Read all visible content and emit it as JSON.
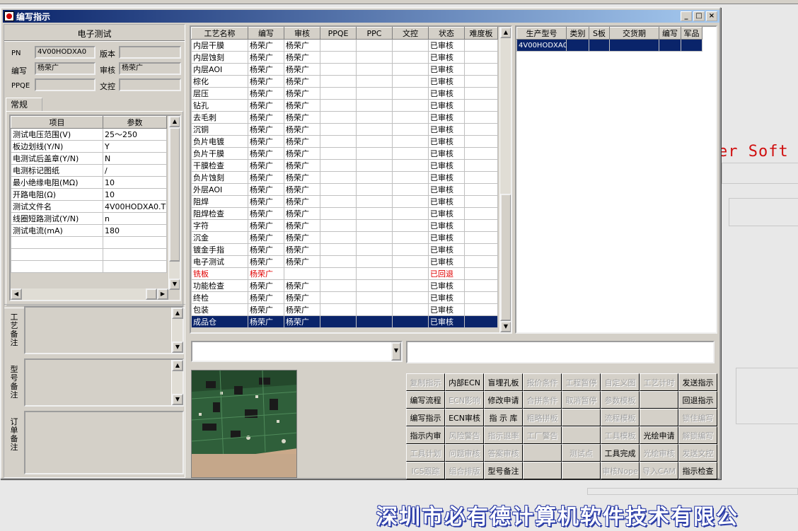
{
  "window": {
    "title": "编写指示",
    "min": "_",
    "max": "□",
    "close": "×"
  },
  "desktop": {
    "soft_text": "er Soft",
    "company_text": "深圳市必有德计算机软件技术有限公"
  },
  "left": {
    "section_title": "电子测试",
    "pn_label": "PN",
    "pn_value": "4V00HODXA0",
    "version_label": "版本",
    "version_value": "",
    "writer_label": "编写",
    "writer_value": "杨荣广",
    "reviewer_label": "审核",
    "reviewer_value": "杨荣广",
    "ppqe_label": "PPQE",
    "ppqe_value": "",
    "control_label": "文控",
    "control_value": "",
    "tab_label": "常规",
    "param_headers": [
      "项目",
      "参数"
    ],
    "params": [
      [
        "测试电压范围(V)",
        "25～250"
      ],
      [
        "板边划线(Y/N)",
        "Y"
      ],
      [
        "电测试后盖章(Y/N)",
        "N"
      ],
      [
        "电测标记图纸",
        "/"
      ],
      [
        "最小绝缘电阻(MΩ)",
        "10"
      ],
      [
        "开路电阻(Ω)",
        "10"
      ],
      [
        "测试文件名",
        "4V00HODXA0.TGZ"
      ],
      [
        "线圈短路测试(Y/N)",
        "n"
      ],
      [
        "测试电流(mA)",
        "180"
      ]
    ],
    "notes": [
      {
        "label": "工艺备注",
        "value": ""
      },
      {
        "label": "型号备注",
        "value": ""
      },
      {
        "label": "订单备注",
        "value": ""
      }
    ]
  },
  "process": {
    "headers": [
      "工艺名称",
      "编写",
      "审核",
      "PPQE",
      "PPC",
      "文控",
      "状态",
      "难度板"
    ],
    "rows": [
      [
        "内层干膜",
        "杨荣广",
        "杨荣广",
        "",
        "",
        "",
        "已审核",
        ""
      ],
      [
        "内层蚀刻",
        "杨荣广",
        "杨荣广",
        "",
        "",
        "",
        "已审核",
        ""
      ],
      [
        "内层AOI",
        "杨荣广",
        "杨荣广",
        "",
        "",
        "",
        "已审核",
        ""
      ],
      [
        "棕化",
        "杨荣广",
        "杨荣广",
        "",
        "",
        "",
        "已审核",
        ""
      ],
      [
        "层压",
        "杨荣广",
        "杨荣广",
        "",
        "",
        "",
        "已审核",
        ""
      ],
      [
        "钻孔",
        "杨荣广",
        "杨荣广",
        "",
        "",
        "",
        "已审核",
        ""
      ],
      [
        "去毛刺",
        "杨荣广",
        "杨荣广",
        "",
        "",
        "",
        "已审核",
        ""
      ],
      [
        "沉铜",
        "杨荣广",
        "杨荣广",
        "",
        "",
        "",
        "已审核",
        ""
      ],
      [
        "负片电镀",
        "杨荣广",
        "杨荣广",
        "",
        "",
        "",
        "已审核",
        ""
      ],
      [
        "负片干膜",
        "杨荣广",
        "杨荣广",
        "",
        "",
        "",
        "已审核",
        ""
      ],
      [
        "干膜检查",
        "杨荣广",
        "杨荣广",
        "",
        "",
        "",
        "已审核",
        ""
      ],
      [
        "负片蚀刻",
        "杨荣广",
        "杨荣广",
        "",
        "",
        "",
        "已审核",
        ""
      ],
      [
        "外层AOI",
        "杨荣广",
        "杨荣广",
        "",
        "",
        "",
        "已审核",
        ""
      ],
      [
        "阻焊",
        "杨荣广",
        "杨荣广",
        "",
        "",
        "",
        "已审核",
        ""
      ],
      [
        "阻焊检查",
        "杨荣广",
        "杨荣广",
        "",
        "",
        "",
        "已审核",
        ""
      ],
      [
        "字符",
        "杨荣广",
        "杨荣广",
        "",
        "",
        "",
        "已审核",
        ""
      ],
      [
        "沉金",
        "杨荣广",
        "杨荣广",
        "",
        "",
        "",
        "已审核",
        ""
      ],
      [
        "镀金手指",
        "杨荣广",
        "杨荣广",
        "",
        "",
        "",
        "已审核",
        ""
      ],
      [
        "电子测试",
        "杨荣广",
        "杨荣广",
        "",
        "",
        "",
        "已审核",
        ""
      ],
      [
        "铣板",
        "杨荣广",
        "",
        "",
        "",
        "",
        "已回退",
        ""
      ],
      [
        "功能检查",
        "杨荣广",
        "杨荣广",
        "",
        "",
        "",
        "已审核",
        ""
      ],
      [
        "终检",
        "杨荣广",
        "杨荣广",
        "",
        "",
        "",
        "已审核",
        ""
      ],
      [
        "包装",
        "杨荣广",
        "杨荣广",
        "",
        "",
        "",
        "已审核",
        ""
      ],
      [
        "成品仓",
        "杨荣广",
        "杨荣广",
        "",
        "",
        "",
        "已审核",
        ""
      ]
    ],
    "returned_row": 19,
    "selected_row": 23
  },
  "models": {
    "headers": [
      "生产型号",
      "类别",
      "S板",
      "交货期",
      "编写",
      "军品"
    ],
    "rows": [
      [
        "4V00HODXA0",
        "",
        "",
        "",
        "",
        ""
      ]
    ]
  },
  "buttons": [
    [
      {
        "t": "复制指示",
        "d": true
      },
      {
        "t": "内部ECN",
        "d": false
      },
      {
        "t": "盲埋孔板",
        "d": false
      },
      {
        "t": "报价条件",
        "d": true
      },
      {
        "t": "工程暂停",
        "d": true
      },
      {
        "t": "自定义图",
        "d": true
      },
      {
        "t": "工艺计时",
        "d": true
      },
      {
        "t": "发送指示",
        "d": false
      }
    ],
    [
      {
        "t": "编写流程",
        "d": false
      },
      {
        "t": "ECN影响",
        "d": true
      },
      {
        "t": "修改申请",
        "d": false
      },
      {
        "t": "合拼条件",
        "d": true
      },
      {
        "t": "取消暂停",
        "d": true
      },
      {
        "t": "参数模板",
        "d": true
      },
      {
        "t": "",
        "d": true
      },
      {
        "t": "回退指示",
        "d": false
      }
    ],
    [
      {
        "t": "编写指示",
        "d": false
      },
      {
        "t": "ECN审核",
        "d": false
      },
      {
        "t": "指 示 库",
        "d": false
      },
      {
        "t": "粗略拼板",
        "d": true
      },
      {
        "t": "",
        "d": true
      },
      {
        "t": "流程模板",
        "d": true
      },
      {
        "t": "",
        "d": true
      },
      {
        "t": "锁住编写",
        "d": true
      }
    ],
    [
      {
        "t": "指示内审",
        "d": false
      },
      {
        "t": "风险警告",
        "d": true
      },
      {
        "t": "指示退率",
        "d": true
      },
      {
        "t": "工厂警告",
        "d": true
      },
      {
        "t": "",
        "d": true
      },
      {
        "t": "工具模板",
        "d": true
      },
      {
        "t": "光绘申请",
        "d": false
      },
      {
        "t": "解锁编写",
        "d": true
      }
    ],
    [
      {
        "t": "工具计划",
        "d": true
      },
      {
        "t": "问题审核",
        "d": true
      },
      {
        "t": "答案审核",
        "d": true
      },
      {
        "t": "",
        "d": true
      },
      {
        "t": "测试点",
        "d": true
      },
      {
        "t": "工具完成",
        "d": false
      },
      {
        "t": "光绘审核",
        "d": true
      },
      {
        "t": "发送文控",
        "d": true
      }
    ],
    [
      {
        "t": "ICS跟踪",
        "d": true
      },
      {
        "t": "组合排版",
        "d": true
      },
      {
        "t": "型号备注",
        "d": false
      },
      {
        "t": "",
        "d": true
      },
      {
        "t": "",
        "d": true
      },
      {
        "t": "审核Nope",
        "d": true
      },
      {
        "t": "导入CAM",
        "d": true
      },
      {
        "t": "指示检查",
        "d": false
      }
    ]
  ]
}
